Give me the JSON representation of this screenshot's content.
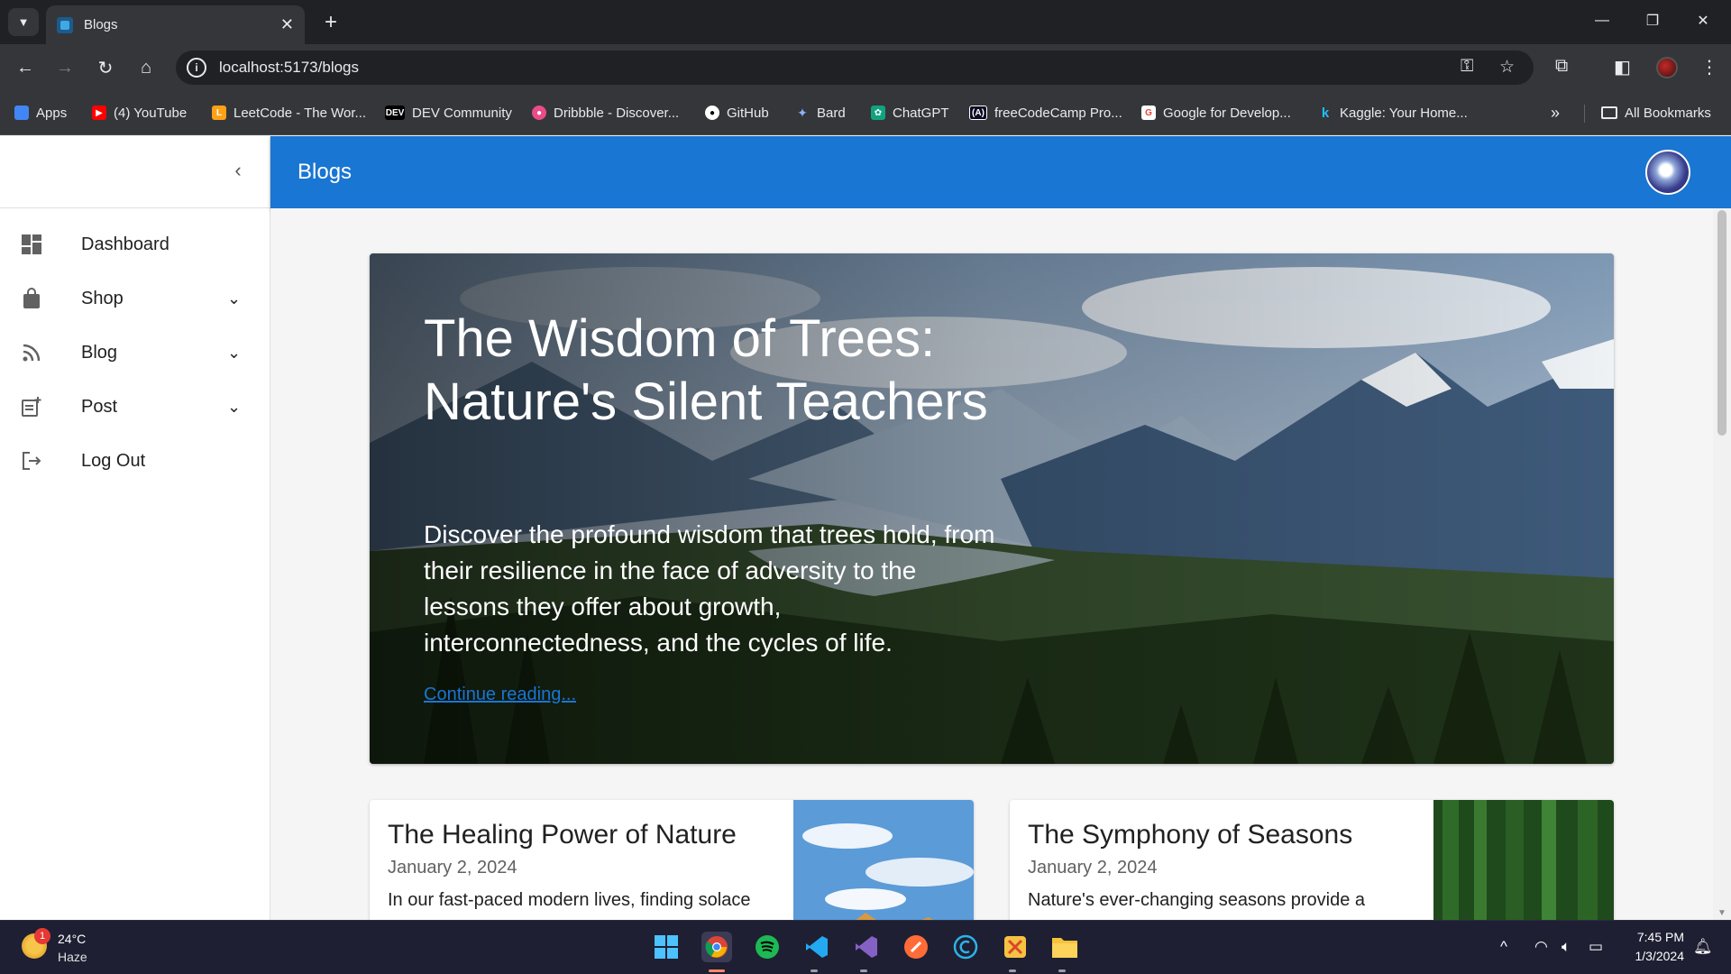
{
  "browser": {
    "tab_title": "Blogs",
    "url": "localhost:5173/blogs",
    "bookmarks": [
      {
        "label": "Apps",
        "color": "#4285f4"
      },
      {
        "label": "(4) YouTube",
        "color": "#ff0000"
      },
      {
        "label": "LeetCode - The Wor...",
        "color": "#ffa116"
      },
      {
        "label": "DEV Community",
        "color": "#000000"
      },
      {
        "label": "Dribbble - Discover...",
        "color": "#ea4c89"
      },
      {
        "label": "GitHub",
        "color": "#24292e"
      },
      {
        "label": "Bard",
        "color": "#8ab4f8"
      },
      {
        "label": "ChatGPT",
        "color": "#10a37f"
      },
      {
        "label": "freeCodeCamp Pro...",
        "color": "#0a0a23"
      },
      {
        "label": "Google for Develop...",
        "color": "#ffffff"
      },
      {
        "label": "Kaggle: Your Home...",
        "color": "#20beff"
      }
    ],
    "all_bookmarks": "All Bookmarks",
    "overflow_glyph": "»"
  },
  "sidebar": {
    "items": [
      {
        "label": "Dashboard",
        "icon": "dashboard-icon",
        "has_submenu": false
      },
      {
        "label": "Shop",
        "icon": "shopping-bag-icon",
        "has_submenu": true
      },
      {
        "label": "Blog",
        "icon": "rss-icon",
        "has_submenu": true
      },
      {
        "label": "Post",
        "icon": "post-add-icon",
        "has_submenu": true
      },
      {
        "label": "Log Out",
        "icon": "logout-icon",
        "has_submenu": false
      }
    ]
  },
  "appbar": {
    "title": "Blogs",
    "color": "#1976d2"
  },
  "hero": {
    "title": "The Wisdom of Trees: Nature's Silent Teachers",
    "description": "Discover the profound wisdom that trees hold, from their resilience in the face of adversity to the lessons they offer about growth, interconnectedness, and the cycles of life.",
    "link_text": "Continue reading..."
  },
  "posts": [
    {
      "title": "The Healing Power of Nature",
      "date": "January 2, 2024",
      "excerpt": "In our fast-paced modern lives, finding solace"
    },
    {
      "title": "The Symphony of Seasons",
      "date": "January 2, 2024",
      "excerpt": "Nature's ever-changing seasons provide a"
    }
  ],
  "taskbar": {
    "temperature": "24°C",
    "condition": "Haze",
    "weather_badge": "1",
    "time": "7:45 PM",
    "date": "1/3/2024"
  }
}
